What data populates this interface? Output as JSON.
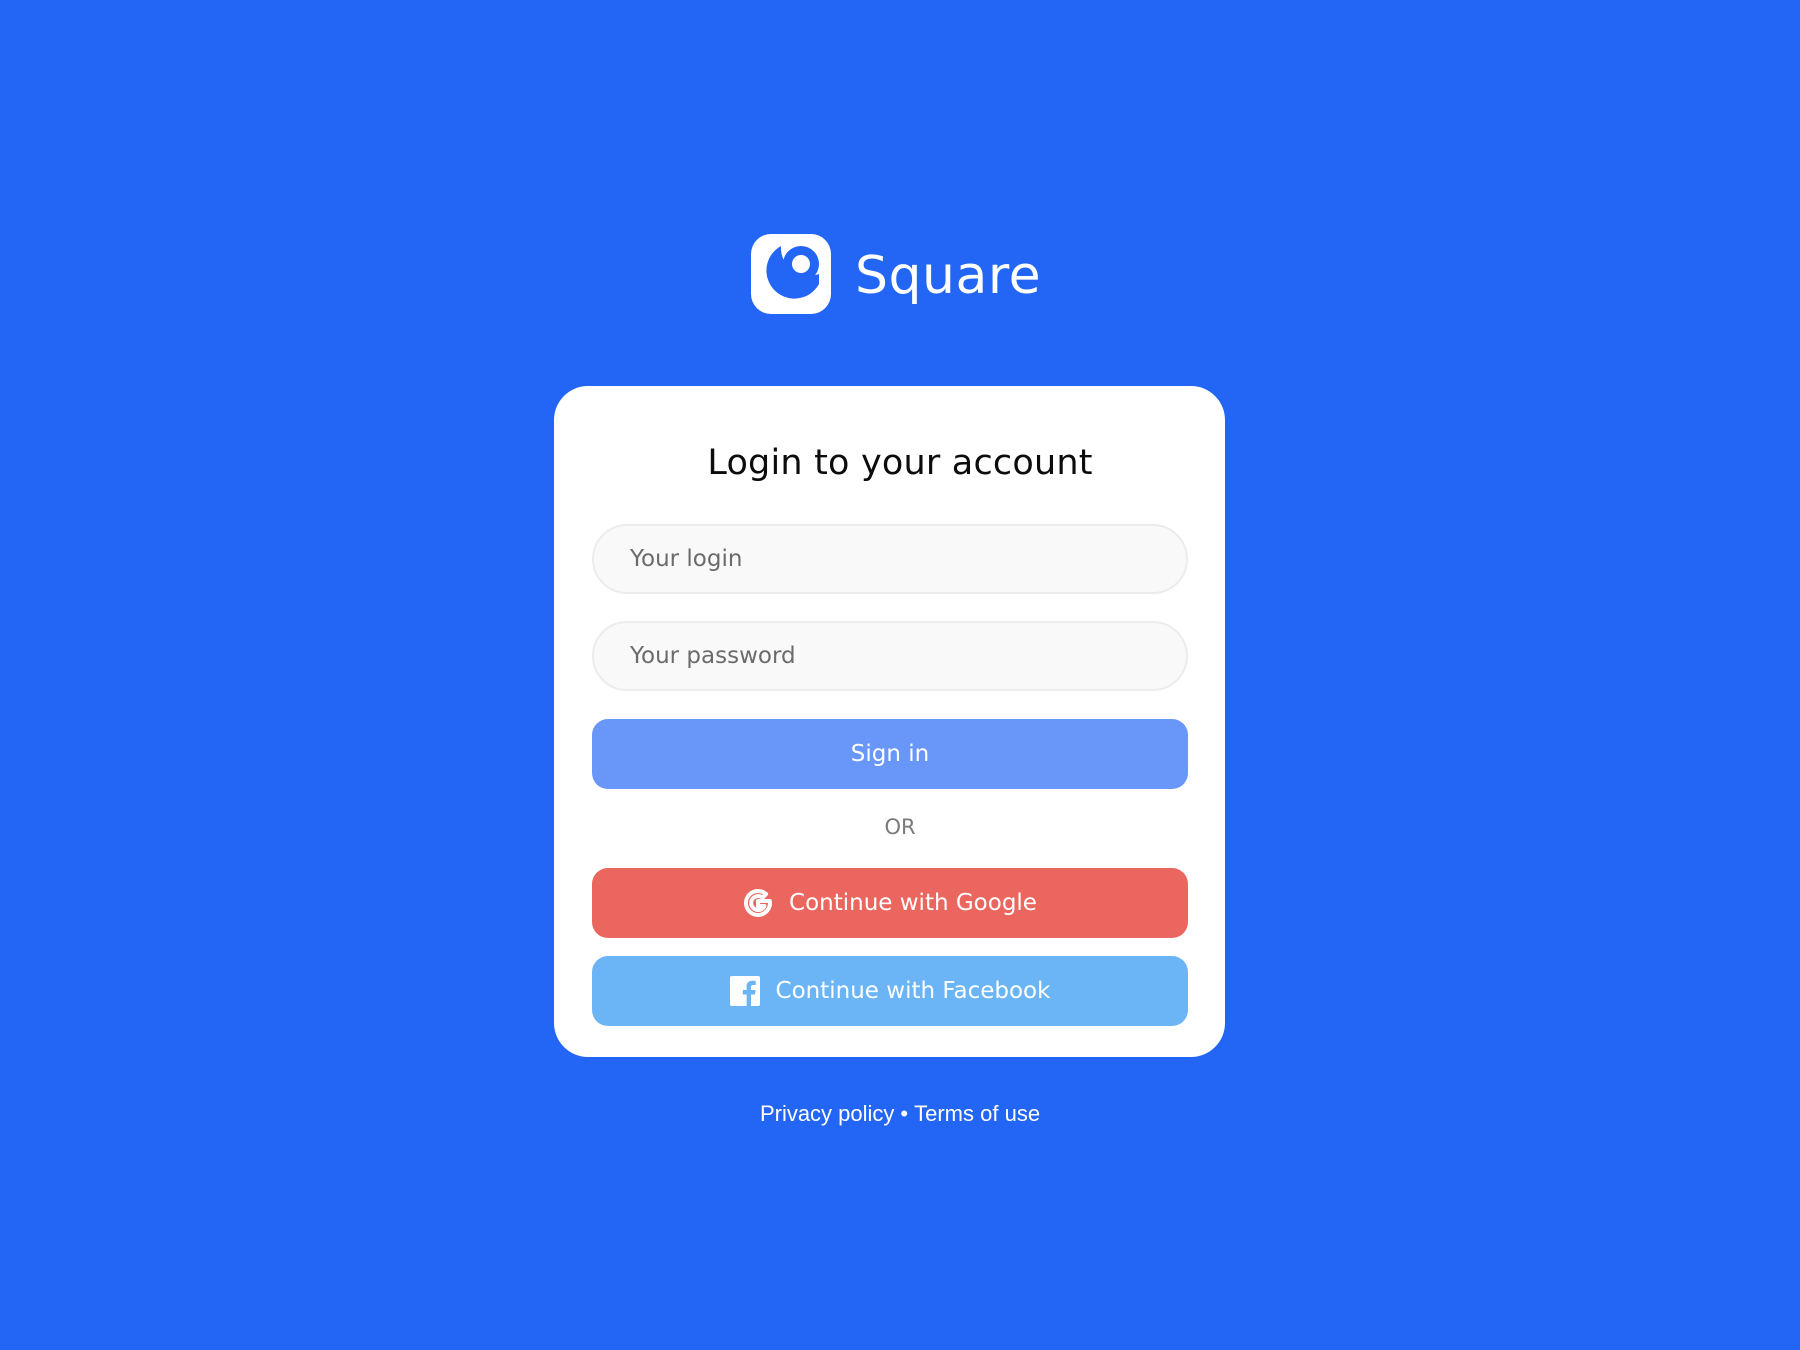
{
  "brand": {
    "name": "Square",
    "logo_icon": "square-logo-icon",
    "color": "#FFFFFF"
  },
  "background_color": "#2366F6",
  "card": {
    "title": "Login to your account",
    "login_field": {
      "placeholder": "Your login",
      "value": ""
    },
    "password_field": {
      "placeholder": "Your password",
      "value": ""
    },
    "sign_in": {
      "label": "Sign in",
      "color": "#6896F9"
    },
    "divider": "OR",
    "google": {
      "label": "Continue with Google",
      "icon": "google-icon",
      "color": "#EB665E"
    },
    "facebook": {
      "label": "Continue with Facebook",
      "icon": "facebook-icon",
      "color": "#6BB5F7"
    }
  },
  "footer": {
    "privacy": "Privacy policy",
    "separator": "•",
    "terms": "Terms of use"
  }
}
